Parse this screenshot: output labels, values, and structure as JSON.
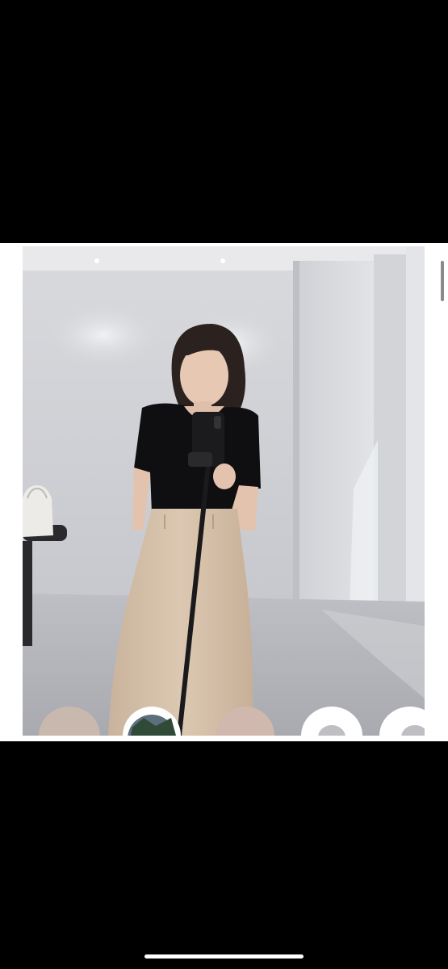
{
  "viewer": {
    "photo_alt": "",
    "thumbnail_count": 6,
    "colors": {
      "background": "#000000",
      "frame": "#ffffff",
      "home_indicator": "#ffffff"
    }
  }
}
